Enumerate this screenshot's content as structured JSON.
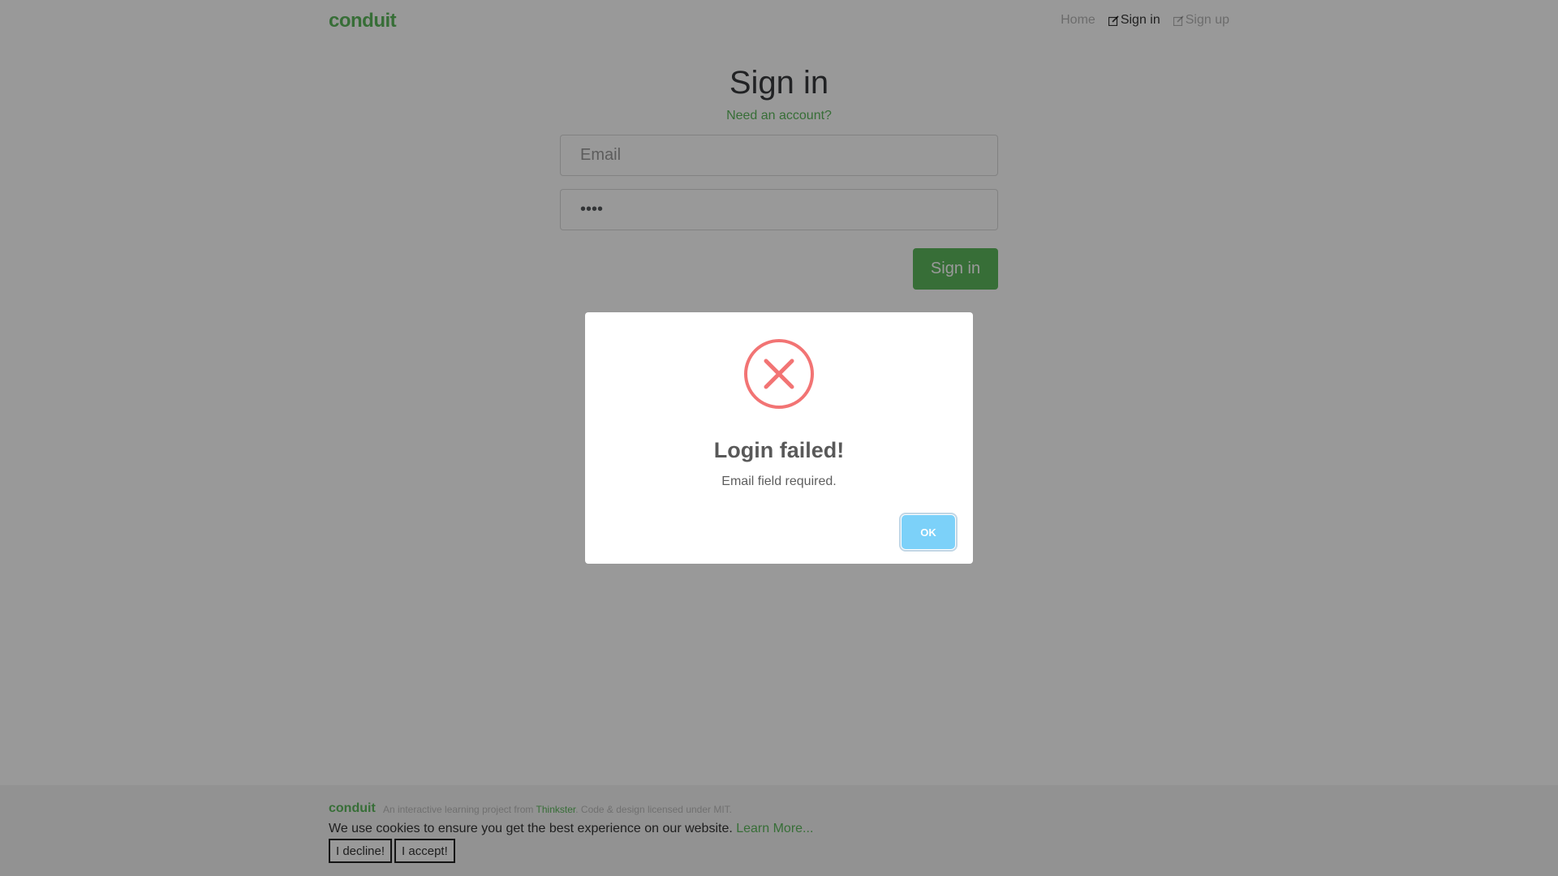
{
  "navbar": {
    "brand": "conduit",
    "items": [
      {
        "label": "Home",
        "icon": null,
        "active": false
      },
      {
        "label": "Sign in",
        "icon": "edit-icon",
        "active": true
      },
      {
        "label": "Sign up",
        "icon": "edit-icon",
        "active": false
      }
    ]
  },
  "auth": {
    "title": "Sign in",
    "need_account": "Need an account?",
    "email_placeholder": "Email",
    "password_value": "••••",
    "submit_label": "Sign in"
  },
  "footer": {
    "brand": "conduit",
    "attribution_prefix": "An interactive learning project from",
    "attribution_link": "Thinkster",
    "attribution_suffix": ". Code & design licensed under MIT."
  },
  "cookie": {
    "text": "We use cookies to ensure you get the best experience on our website.",
    "learn_more": "Learn More...",
    "decline_label": "I decline!",
    "accept_label": "I accept!"
  },
  "modal": {
    "icon": "error-x-icon",
    "title": "Login failed!",
    "text": "Email field required.",
    "ok_label": "OK"
  },
  "colors": {
    "brand_green": "#5cb85c",
    "error_red": "#f27474",
    "ok_blue": "#7cd1f9"
  }
}
